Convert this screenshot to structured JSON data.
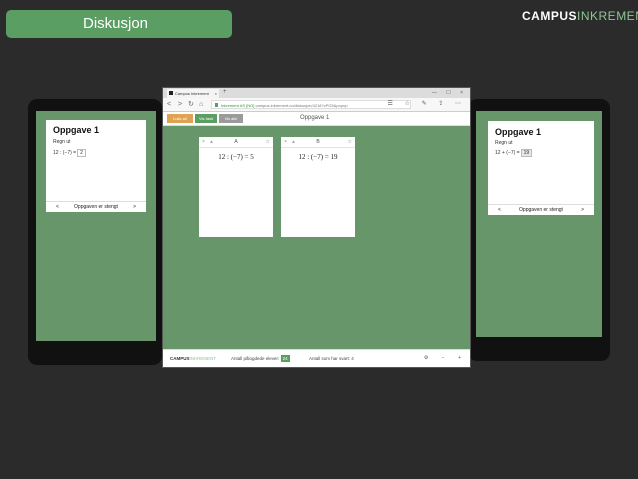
{
  "slide_title": "Diskusjon",
  "logo": {
    "part1": "CAMPUS",
    "part2": "INKREMENT"
  },
  "left_phone": {
    "title": "Oppgave 1",
    "subtitle": "Regn ut",
    "eq_left": "12 : (−7) =",
    "answer": "2",
    "footer_prev": "<",
    "footer_text": "Oppgaven er stengt",
    "footer_next": ">"
  },
  "right_phone": {
    "title": "Oppgave 1",
    "subtitle": "Regn ut",
    "eq_left": "12 + (−7) =",
    "answer": "19",
    "footer_prev": "<",
    "footer_text": "Oppgaven er stengt",
    "footer_next": ">"
  },
  "browser": {
    "tab_label": "Campus Inkrement",
    "tab_close": "×",
    "new_tab": "+",
    "window_controls": "— ☐ ×",
    "back": "<",
    "forward": ">",
    "reload": "↻",
    "home": "⌂",
    "url_site": "Inkrement AS [NO]",
    "url_rest": "campus.inkrement.no/diskusjon/4218?cPG5&popup",
    "nav_right": "☰ ☆ ✎ ⇪ ⋯",
    "buttons": [
      {
        "label": "Lukk alt",
        "color": "#e0a354"
      },
      {
        "label": "Vis fasit",
        "color": "#5a9e63"
      },
      {
        "label": "Vis alle",
        "color": "#9a9a9a"
      }
    ],
    "page_title": "Oppgave 1",
    "cards": [
      {
        "close": "×",
        "label": "A",
        "star": "☆",
        "expr": "12 : (−7) = 5"
      },
      {
        "close": "×",
        "label": "B",
        "star": "☆",
        "expr": "12 : (−7) = 19"
      }
    ],
    "footer": {
      "logo1": "CAMPUS",
      "logo2": "INKREMENT",
      "participants_label": "Antall pålogdede elever:",
      "participants_count": "24",
      "answers_label": "Antall som har svart: 4",
      "zoom_controls": "⚙ − +"
    }
  }
}
